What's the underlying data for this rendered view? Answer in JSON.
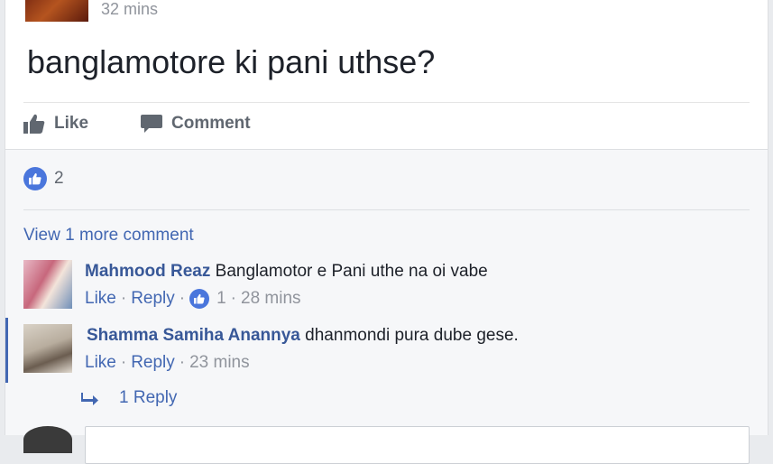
{
  "post": {
    "time": "32 mins",
    "text": "banglamotore ki pani uthse?",
    "actions": {
      "like_label": "Like",
      "comment_label": "Comment"
    },
    "reaction_count": "2"
  },
  "comments": {
    "view_more": "View 1 more comment",
    "items": [
      {
        "name": "Mahmood Reaz",
        "text": "Banglamotor e Pani uthe na oi vabe",
        "like_label": "Like",
        "reply_label": "Reply",
        "like_count": "1",
        "time": "28 mins"
      },
      {
        "name": "Shamma Samiha Anannya",
        "text": "dhanmondi pura dube gese.",
        "like_label": "Like",
        "reply_label": "Reply",
        "time": "23 mins"
      }
    ],
    "replies_label": "1 Reply"
  },
  "icons": {
    "like": "thumbs-up-icon",
    "comment": "comment-bubble-icon",
    "reply_arrow": "reply-arrow-icon"
  },
  "colors": {
    "accent": "#4267b2",
    "like_blue": "#4a76dc",
    "name": "#385898",
    "muted": "#90949c"
  }
}
